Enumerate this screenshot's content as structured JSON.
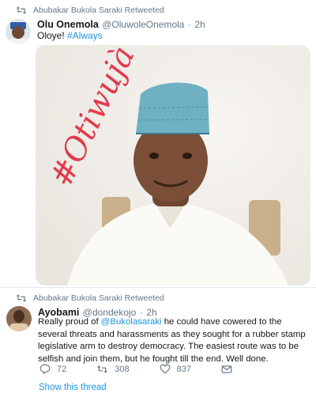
{
  "tweet1": {
    "retweet_label": "Abubakar Bukola Saraki Retweeted",
    "author_name": "Olu Onemola",
    "author_handle": "@OluwoleOnemola",
    "separator": "·",
    "time": "2h",
    "text_prefix": "Oloye! ",
    "hashtag": "#Always",
    "media_graphic_text": "#Otiwujà"
  },
  "tweet2": {
    "retweet_label": "Abubakar Bukola Saraki Retweeted",
    "author_name": "Ayobami",
    "author_handle": "@dondekojo",
    "separator": "·",
    "time": "2h",
    "text_before_mention": "Really proud of ",
    "mention": "@Bukolasaraki",
    "text_after_mention": " he could have cowered to the several threats and harassments as they sought for a rubber stamp legislative arm to destroy democracy. The easiest route was to be selfish and join them, but he fought till the end. Well done.",
    "actions": {
      "reply_count": "72",
      "retweet_count": "308",
      "like_count": "837"
    },
    "show_thread": "Show this thread"
  },
  "colors": {
    "link": "#1b95e0",
    "secondary_text": "#657786",
    "graphic_red": "#e23a4b"
  }
}
